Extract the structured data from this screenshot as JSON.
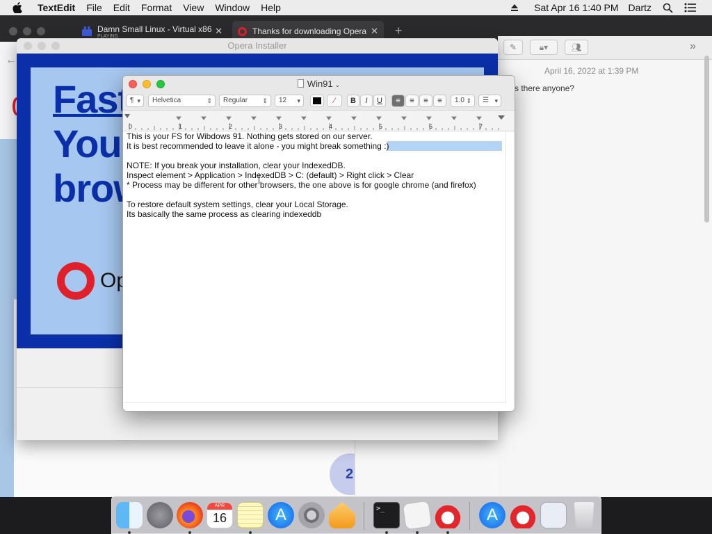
{
  "menubar": {
    "app": "TextEdit",
    "items": [
      "File",
      "Edit",
      "Format",
      "View",
      "Window",
      "Help"
    ],
    "clock": "Sat Apr 16  1:40 PM",
    "user": "Dartz"
  },
  "browser": {
    "tabs": [
      {
        "title": "Damn Small Linux - Virtual x86",
        "subtitle": "PLAYING"
      },
      {
        "title": "Thanks for downloading Opera"
      }
    ],
    "new_tab": "+"
  },
  "messages": {
    "timestamp": "April 16, 2022 at 1:39 PM",
    "snippet": "s there anyone?",
    "badge": "2"
  },
  "installer": {
    "title": "Opera Installer",
    "hero_lines": [
      "Fast",
      "You",
      "brow"
    ],
    "logo_text": "Op"
  },
  "textedit": {
    "title": "Win91",
    "toolbar": {
      "paragraph": "¶",
      "font": "Helvetica",
      "style": "Regular",
      "size": "12",
      "bold": "B",
      "italic": "I",
      "underline": "U",
      "spacing": "1.0"
    },
    "ruler_numbers": [
      "0",
      "1",
      "2",
      "3",
      "4",
      "5",
      "6",
      "7"
    ],
    "lines": [
      "This is your FS for Wibdows 91. Nothing gets stored on our server.",
      "It is best recommended to leave it alone - you might break something :)",
      "",
      "NOTE: If you break your installation, clear your IndexedDB.",
      "Inspect element > Application > IndexedDB > C: (default) > Right click > Clear",
      "* Process may be different for other browsers, the one above is for google chrome (and firefox)",
      "",
      "To restore default system settings, clear your Local Storage.",
      "Its basically the same process as clearing indexeddb"
    ]
  },
  "dock": {
    "calendar_month": "APR",
    "calendar_day": "16"
  }
}
